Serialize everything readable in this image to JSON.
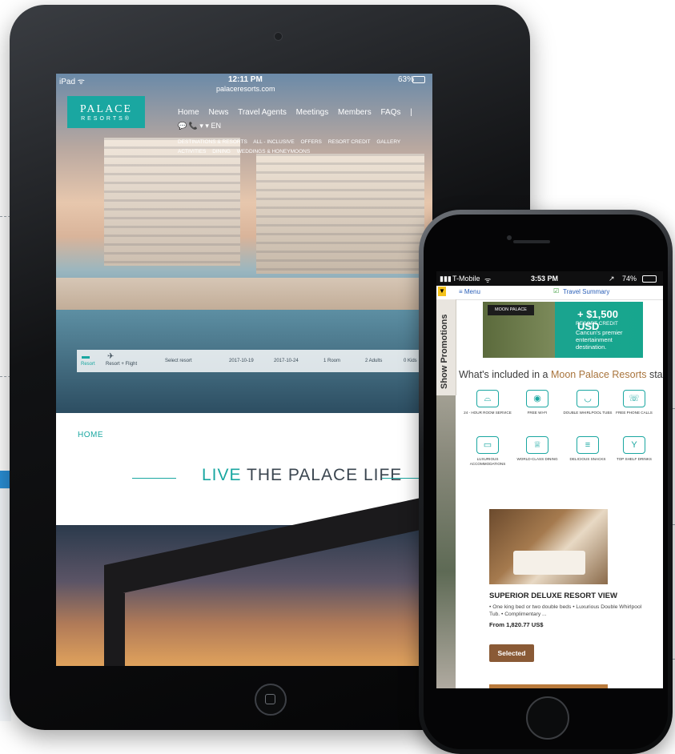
{
  "ipad": {
    "status_left": "iPad ᯤ",
    "time": "12:11 PM",
    "url": "palaceresorts.com",
    "battery": "63%",
    "logo_top": "PALACE",
    "logo_bottom": "RESORTS®",
    "nav": [
      "Home",
      "News",
      "Travel Agents",
      "Meetings",
      "Members",
      "FAQs",
      "|"
    ],
    "phone_row": "💬  📞          ▾     ▾ EN",
    "subnav": [
      "DESTINATIONS & RESORTS",
      "ALL - INCLUSIVE",
      "OFFERS",
      "RESORT CREDIT",
      "GALLERY",
      "ACTIVITIES",
      "DINING",
      "WEDDINGS & HONEYMOONS"
    ],
    "booking": {
      "resort": "Resort",
      "resort_flight": "Resort + Flight",
      "select": "Select resort",
      "checkin": "2017-10-19",
      "checkout": "2017-10-24",
      "rooms": "1 Room",
      "adults": "2 Adults",
      "kids": "0 Kids"
    },
    "breadcrumb": "HOME",
    "tagline_accent": "LIVE",
    "tagline_rest": " THE PALACE LIFE"
  },
  "iphone": {
    "carrier": "T-Mobile",
    "time": "3:53 PM",
    "battery": "74%",
    "menu": "≡ Menu",
    "travel_summary": "Travel Summary",
    "promo_tab": "Show Promotions",
    "banner": {
      "brand": "MOON PALACE",
      "amount": "+ $1,500 USD",
      "credit": "RESORT CREDIT",
      "text": "Cancun's premier entertainment destination."
    },
    "question_pre": "What's included in a ",
    "question_accent": "Moon Palace Resorts",
    "question_post": " stay?",
    "amenities": [
      {
        "label": "24 - HOUR ROOM SERVICE",
        "icon": "room-service-icon"
      },
      {
        "label": "FREE WI-FI",
        "icon": "wifi-icon"
      },
      {
        "label": "DOUBLE WHIRLPOOL TUBS",
        "icon": "bathtub-icon"
      },
      {
        "label": "FREE PHONE CALLS",
        "icon": "phone-icon"
      },
      {
        "label": "LUXURIOUS ACCOMMODATIONS",
        "icon": "bed-icon"
      },
      {
        "label": "WORLD-CLASS DINING",
        "icon": "chef-hat-icon"
      },
      {
        "label": "DELICIOUS SNACKS",
        "icon": "burger-icon"
      },
      {
        "label": "TOP SHELF DRINKS",
        "icon": "cocktail-icon"
      }
    ],
    "room": {
      "title": "SUPERIOR DELUXE RESORT VIEW",
      "desc": "• One king bed or two double beds • Luxurious Double Whirlpool Tub. • Complimentary ...",
      "price": "From 1,820.77 US$",
      "button": "Selected"
    }
  }
}
